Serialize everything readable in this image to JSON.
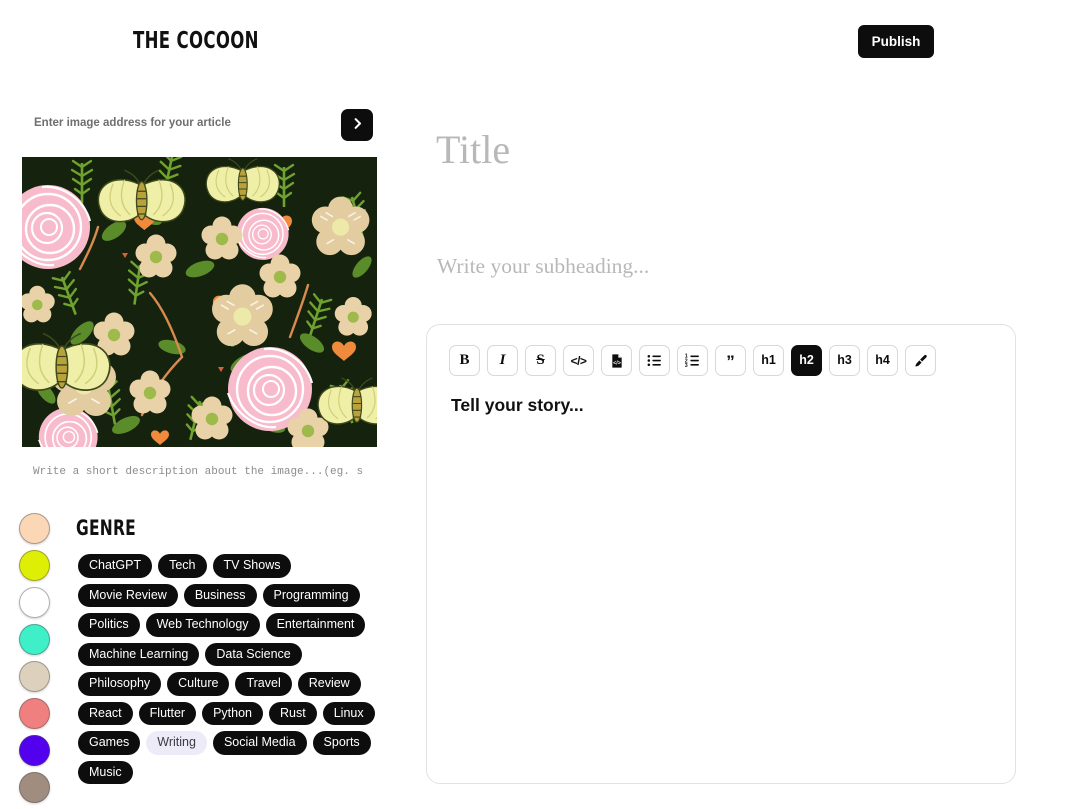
{
  "header": {
    "logo": "THE COCOON",
    "publish_label": "Publish"
  },
  "left_panel": {
    "image_address": {
      "placeholder": "Enter image address for your article",
      "value": "",
      "submit_icon": "chevron-right-icon"
    },
    "hero_image_alt": "Dark green floral pattern with pink roses, cream flowers, butterflies and green leaves",
    "caption": {
      "placeholder": "Write a short description about the image...(eg. source)",
      "value": ""
    },
    "color_swatches": [
      {
        "name": "peach",
        "hex": "#FBD7B6"
      },
      {
        "name": "chartreuse",
        "hex": "#DEEE04"
      },
      {
        "name": "white",
        "hex": "#FFFFFF"
      },
      {
        "name": "turquoise",
        "hex": "#3FEFC8"
      },
      {
        "name": "beige",
        "hex": "#DDD1BE"
      },
      {
        "name": "salmon",
        "hex": "#F08080"
      },
      {
        "name": "blue-violet",
        "hex": "#5200EE"
      },
      {
        "name": "taupe",
        "hex": "#A08D80"
      }
    ],
    "genre": {
      "title": "GENRE",
      "tags": [
        {
          "label": "ChatGPT",
          "selected": false
        },
        {
          "label": "Tech",
          "selected": false
        },
        {
          "label": "TV Shows",
          "selected": false
        },
        {
          "label": "Movie Review",
          "selected": false
        },
        {
          "label": "Business",
          "selected": false
        },
        {
          "label": "Programming",
          "selected": false
        },
        {
          "label": "Politics",
          "selected": false
        },
        {
          "label": "Web Technology",
          "selected": false
        },
        {
          "label": "Entertainment",
          "selected": false
        },
        {
          "label": "Machine Learning",
          "selected": false
        },
        {
          "label": "Data Science",
          "selected": false
        },
        {
          "label": "Philosophy",
          "selected": false
        },
        {
          "label": "Culture",
          "selected": false
        },
        {
          "label": "Travel",
          "selected": false
        },
        {
          "label": "Review",
          "selected": false
        },
        {
          "label": "React",
          "selected": false
        },
        {
          "label": "Flutter",
          "selected": false
        },
        {
          "label": "Python",
          "selected": false
        },
        {
          "label": "Rust",
          "selected": false
        },
        {
          "label": "Linux",
          "selected": false
        },
        {
          "label": "Games",
          "selected": false
        },
        {
          "label": "Writing",
          "selected": true
        },
        {
          "label": "Social Media",
          "selected": false
        },
        {
          "label": "Sports",
          "selected": false
        },
        {
          "label": "Music",
          "selected": false
        }
      ]
    }
  },
  "editor": {
    "title": {
      "placeholder": "Title",
      "value": ""
    },
    "subheading": {
      "placeholder": "Write your subheading...",
      "value": ""
    },
    "body": {
      "placeholder": "Tell your story...",
      "value": ""
    },
    "toolbar": [
      {
        "name": "bold-button",
        "glyph": "B",
        "style": "serif-b",
        "active": false
      },
      {
        "name": "italic-button",
        "glyph": "I",
        "style": "serif-i",
        "active": false
      },
      {
        "name": "strikethrough-button",
        "glyph": "S",
        "style": "serif-s",
        "active": false
      },
      {
        "name": "inline-code-button",
        "glyph": "</>",
        "style": "code-tag",
        "active": false
      },
      {
        "name": "code-block-button",
        "glyph": "",
        "style": "icon-codeblock",
        "active": false
      },
      {
        "name": "bullet-list-button",
        "glyph": "",
        "style": "icon-bullet",
        "active": false
      },
      {
        "name": "ordered-list-button",
        "glyph": "",
        "style": "icon-ordered",
        "active": false
      },
      {
        "name": "blockquote-button",
        "glyph": "”",
        "style": "quote",
        "active": false
      },
      {
        "name": "heading-1-button",
        "glyph": "h1",
        "style": "hx",
        "active": false
      },
      {
        "name": "heading-2-button",
        "glyph": "h2",
        "style": "hx",
        "active": true
      },
      {
        "name": "heading-3-button",
        "glyph": "h3",
        "style": "hx",
        "active": false
      },
      {
        "name": "heading-4-button",
        "glyph": "h4",
        "style": "hx",
        "active": false
      },
      {
        "name": "highlight-button",
        "glyph": "",
        "style": "icon-brush",
        "active": false
      }
    ]
  },
  "colors": {
    "accent_dark": "#0D0D0D",
    "page_bg": "#FFFFFF",
    "placeholder_gray": "#B8B8B8",
    "selected_tag_bg": "#EDEBF8"
  }
}
